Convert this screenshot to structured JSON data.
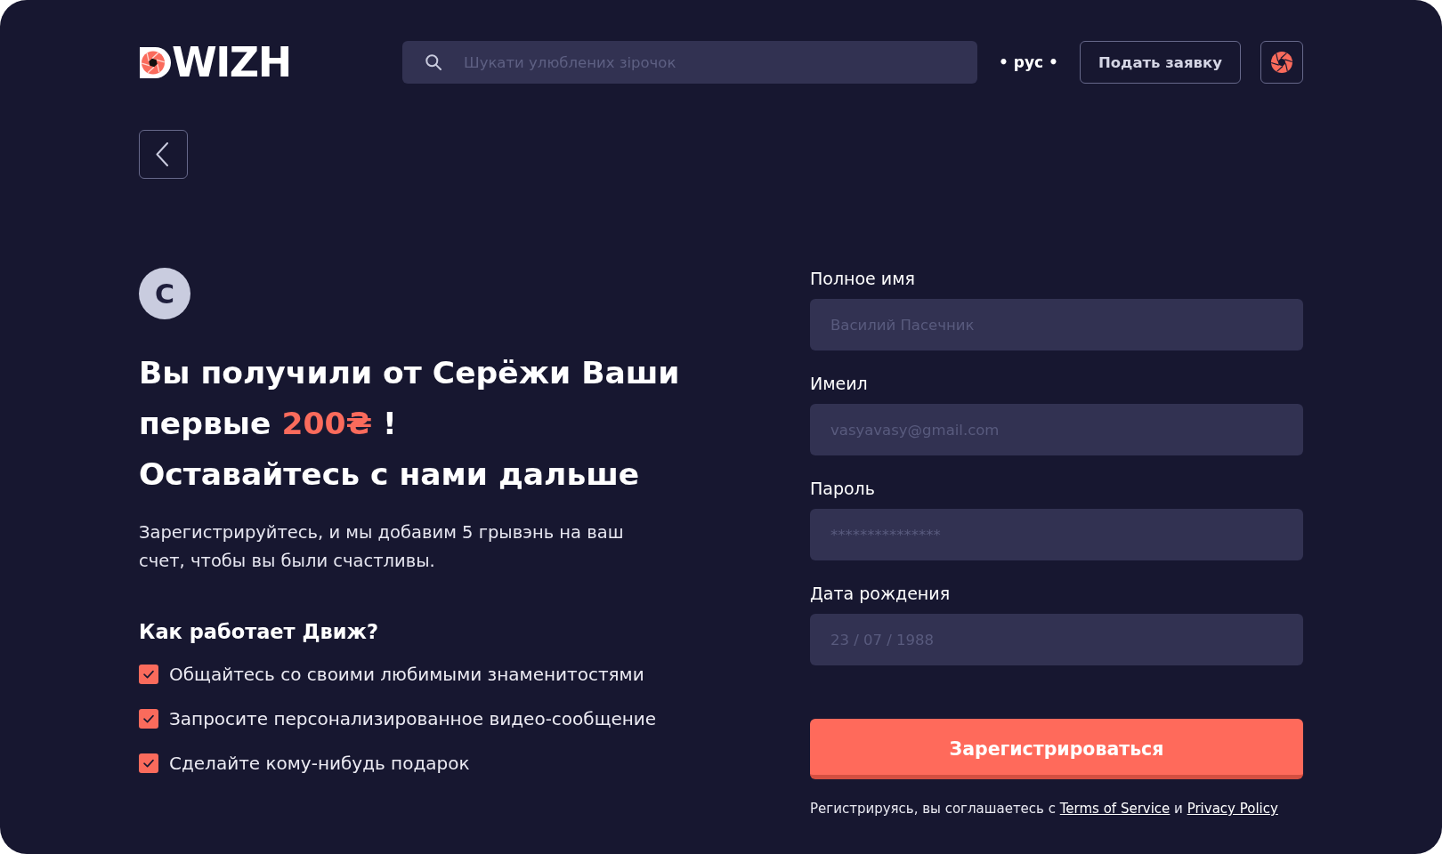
{
  "header": {
    "logo": {
      "text": "WIZH"
    },
    "search": {
      "placeholder": "Шукати улюблених зірочок"
    },
    "language": {
      "label": "• рус •",
      "selected": true
    },
    "apply_button": "Подать заявку"
  },
  "promo": {
    "avatar_initial": "С",
    "headline": {
      "text": "Вы получили от Серёжи Ваши первые",
      "amount": "200₴",
      "suffix": "!"
    },
    "headline_line": "Оставайтесь с нами дальше",
    "description": "Зарегистрируйтесь, и мы добавим 5 грывэнь на ваш счет, чтобы вы были счастливы.",
    "how_it_works": {
      "title": "Как работает Движ?",
      "items": [
        {
          "text": "Общайтесь со своими любимыми знаменитостями",
          "checked": true
        },
        {
          "text": "Запросите персонализированное видео-сообщение",
          "checked": true
        },
        {
          "text": "Сделайте кому-нибудь подарок",
          "checked": true
        }
      ]
    }
  },
  "form": {
    "fields": [
      {
        "label": "Полное имя",
        "placeholder": "Василий Пасечник"
      },
      {
        "label": "Имеил",
        "placeholder": "vasyavasy@gmail.com"
      },
      {
        "label": "Пароль",
        "placeholder": "***************"
      },
      {
        "label": "Дата рождения",
        "placeholder": "23 / 07 / 1988"
      }
    ],
    "submit_button": "Зарегистрироваться",
    "terms": {
      "text": "Регистрируясь, вы соглашаетесь с",
      "links": [
        "Terms of Service",
        "Privacy Policy"
      ],
      "joiner": "и"
    }
  }
}
